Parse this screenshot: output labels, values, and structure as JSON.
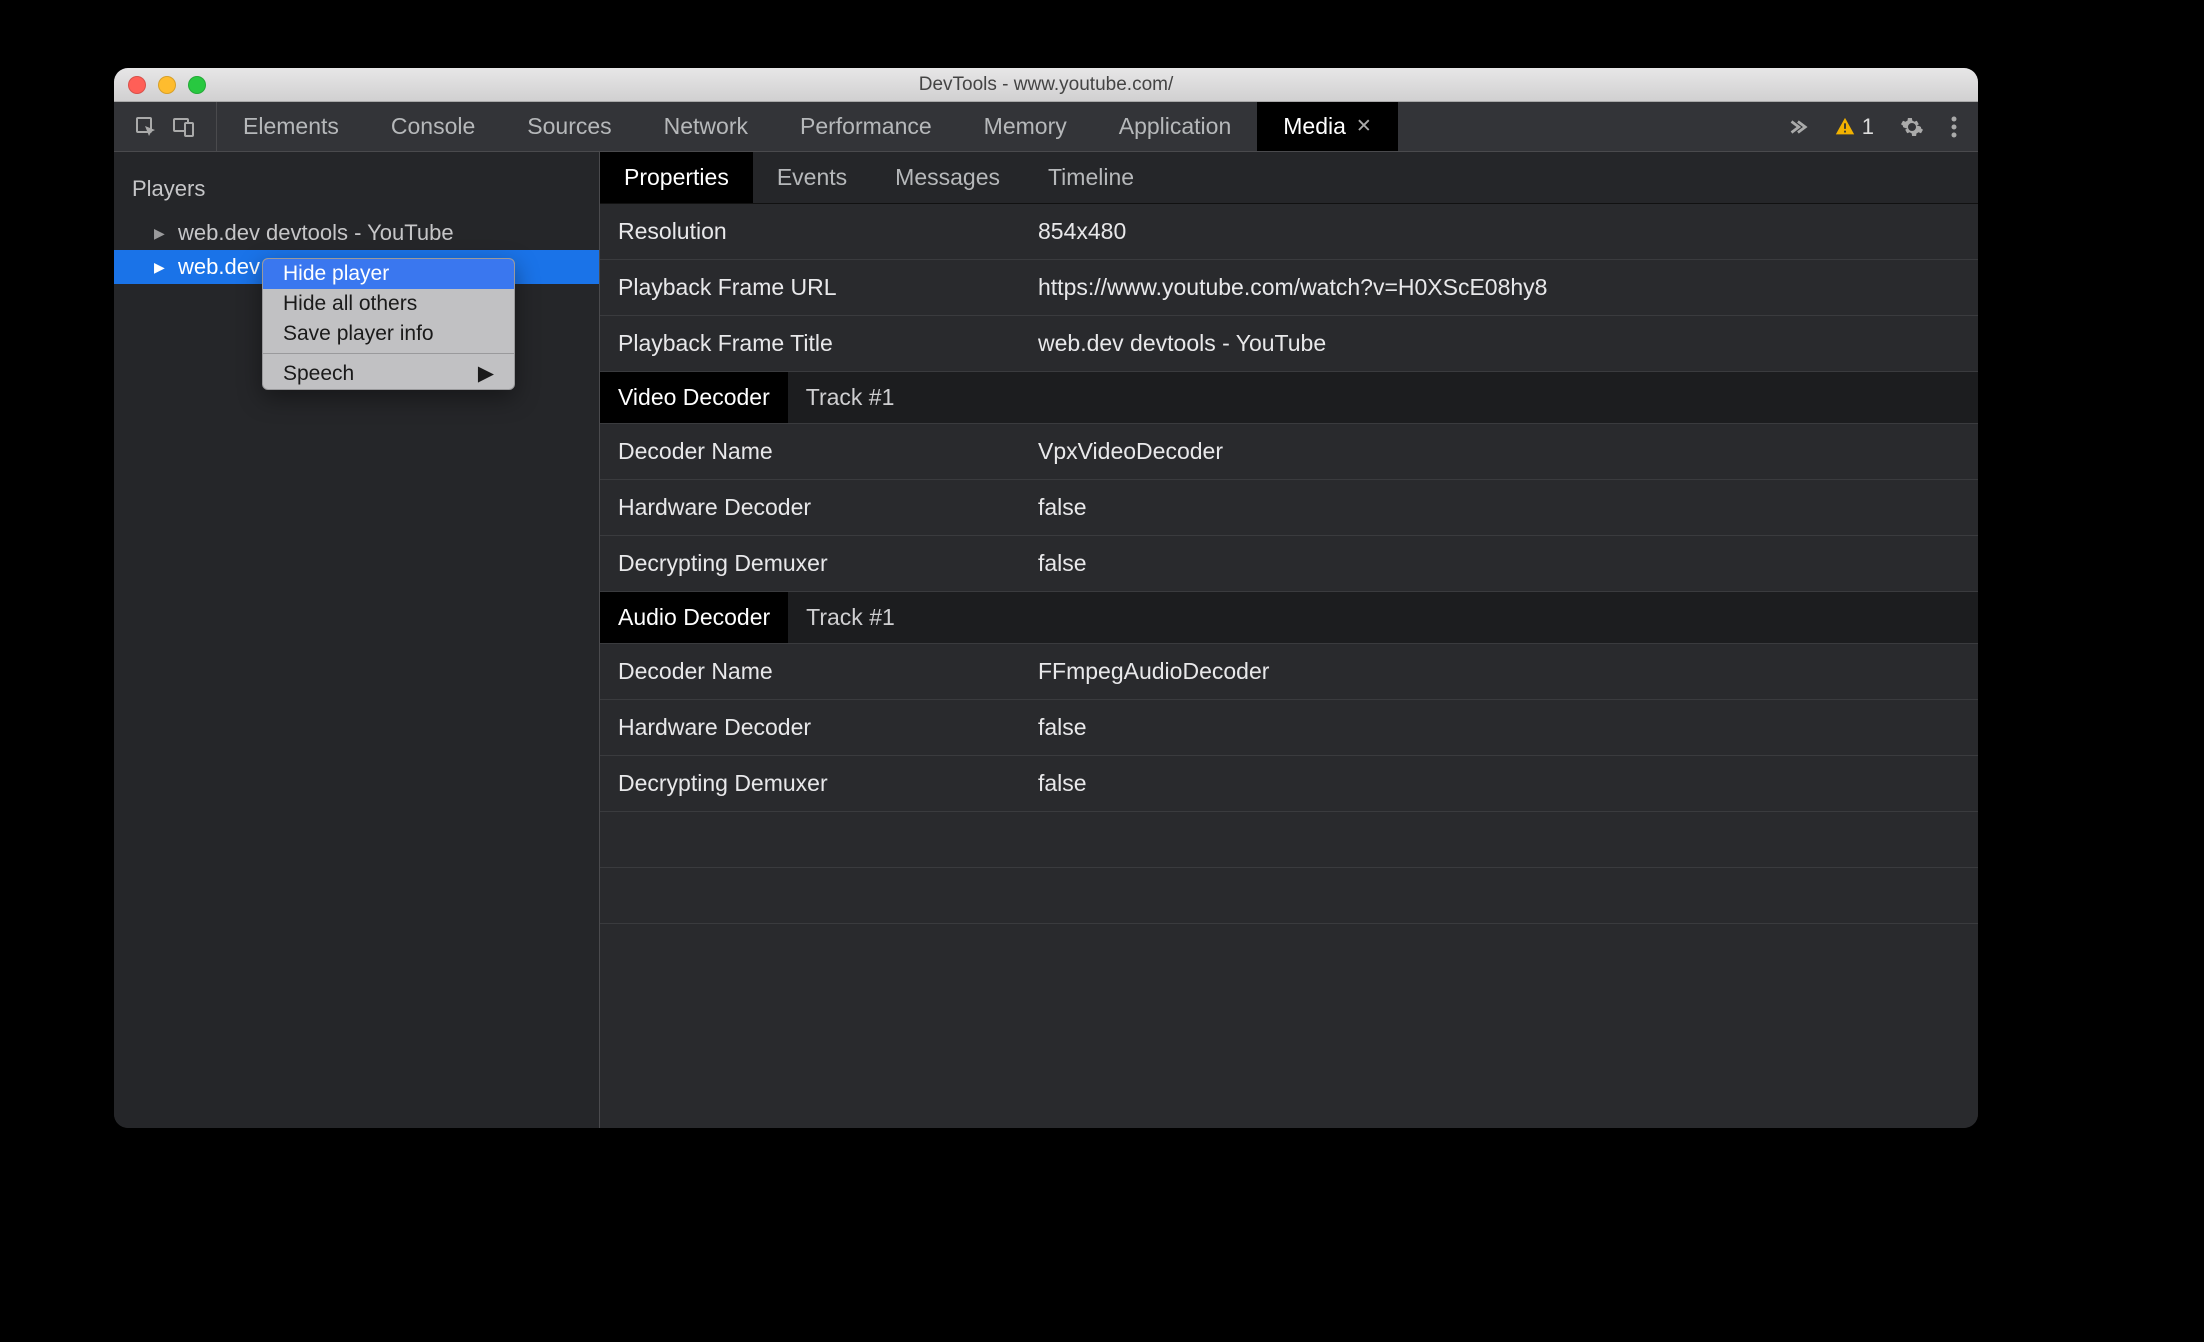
{
  "window": {
    "title": "DevTools - www.youtube.com/"
  },
  "toolbar": {
    "tabs": [
      "Elements",
      "Console",
      "Sources",
      "Network",
      "Performance",
      "Memory",
      "Application",
      "Media"
    ],
    "active_tab": "Media",
    "warning_count": "1"
  },
  "sidebar": {
    "header": "Players",
    "players": [
      {
        "label": "web.dev devtools - YouTube",
        "selected": false
      },
      {
        "label": "web.dev devtools - YouTube",
        "selected": true
      }
    ]
  },
  "context_menu": {
    "items": [
      {
        "label": "Hide player",
        "highlighted": true,
        "submenu": false
      },
      {
        "label": "Hide all others",
        "highlighted": false,
        "submenu": false
      },
      {
        "label": "Save player info",
        "highlighted": false,
        "submenu": false
      }
    ],
    "separator_after": 2,
    "extra": {
      "label": "Speech",
      "submenu": true
    }
  },
  "subtabs": {
    "items": [
      "Properties",
      "Events",
      "Messages",
      "Timeline"
    ],
    "active": "Properties"
  },
  "properties": {
    "top": [
      {
        "label": "Resolution",
        "value": "854x480"
      },
      {
        "label": "Playback Frame URL",
        "value": "https://www.youtube.com/watch?v=H0XScE08hy8"
      },
      {
        "label": "Playback Frame Title",
        "value": "web.dev devtools - YouTube"
      }
    ],
    "video_decoder": {
      "heading": "Video Decoder",
      "track": "Track #1",
      "rows": [
        {
          "label": "Decoder Name",
          "value": "VpxVideoDecoder"
        },
        {
          "label": "Hardware Decoder",
          "value": "false"
        },
        {
          "label": "Decrypting Demuxer",
          "value": "false"
        }
      ]
    },
    "audio_decoder": {
      "heading": "Audio Decoder",
      "track": "Track #1",
      "rows": [
        {
          "label": "Decoder Name",
          "value": "FFmpegAudioDecoder"
        },
        {
          "label": "Hardware Decoder",
          "value": "false"
        },
        {
          "label": "Decrypting Demuxer",
          "value": "false"
        }
      ]
    }
  }
}
